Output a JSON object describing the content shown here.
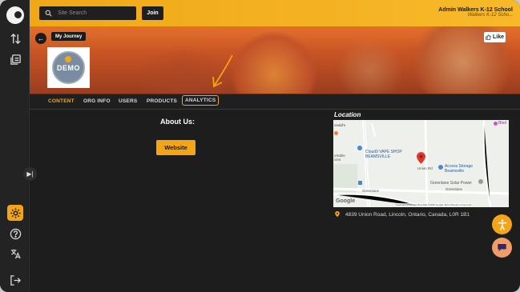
{
  "topbar": {
    "search_placeholder": "Site Search",
    "join_label": "Join",
    "user_name": "Admin Walkers K-12 School",
    "user_sub": "Walkers K-12 Scho..."
  },
  "banner": {
    "journey_label": "My Journey",
    "like_label": "Like",
    "logo_text": "DEMO"
  },
  "tabs": [
    {
      "label": "CONTENT",
      "active": true
    },
    {
      "label": "ORG INFO",
      "active": false
    },
    {
      "label": "USERS",
      "active": false
    },
    {
      "label": "PRODUCTS",
      "active": false
    },
    {
      "label": "ANALYTICS",
      "active": false,
      "highlighted": true
    }
  ],
  "content": {
    "about_title": "About Us:",
    "website_label": "Website"
  },
  "location": {
    "title": "Location",
    "address": "4839 Union Road, Lincoln, Ontario, Canada, L0R 1B1",
    "map_labels": {
      "mcdonalds": "onald's",
      "vape": "Cloud9 VAPE SHOP BEAMSVILLE",
      "storage": "Access Storage Beamsville",
      "solar": "Greenlane Solar Power",
      "union": "Union Rd",
      "greenlane1": "Greenlane",
      "greenlane2": "Greenlane",
      "bled": "Bled",
      "portable": "ortable ions",
      "google": "Google",
      "footer": "Keyboard shortcuts   Map data ©2025 Google   Terms   Report a map error"
    }
  },
  "colors": {
    "accent": "#f3a417",
    "sidebar": "#232323",
    "background": "#1d1d1d"
  }
}
